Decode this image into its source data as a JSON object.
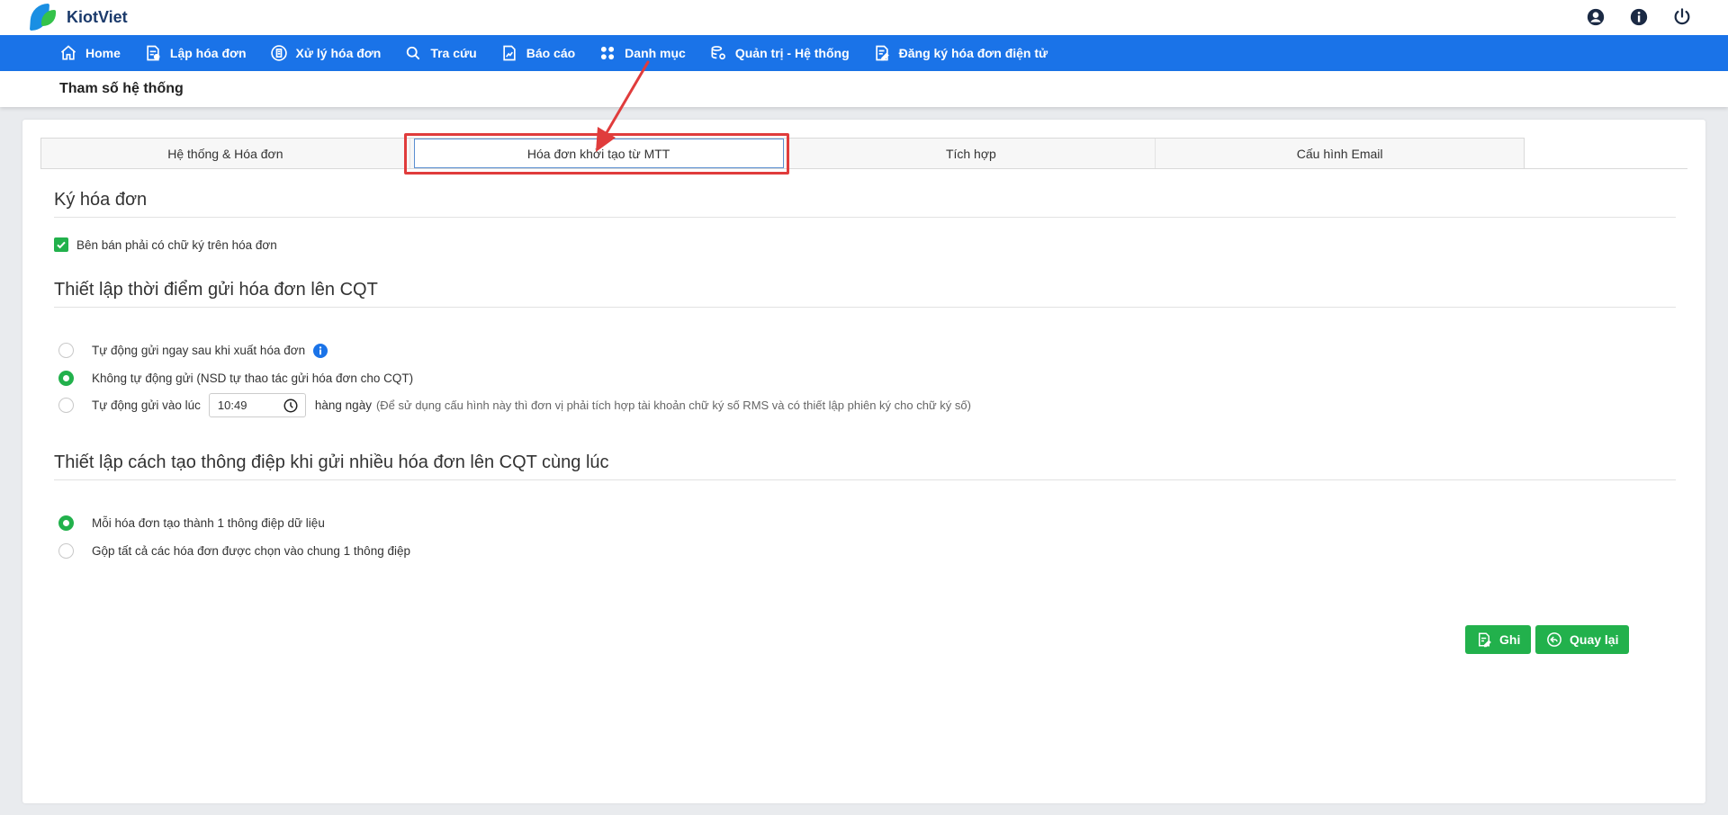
{
  "app": {
    "logo_text": "KiotViet"
  },
  "top_icons": [
    "user-icon",
    "info-icon",
    "power-icon"
  ],
  "nav": [
    {
      "label": "Home",
      "icon": "home-icon"
    },
    {
      "label": "Lập hóa đơn",
      "icon": "create-invoice-icon"
    },
    {
      "label": "Xử lý hóa đơn",
      "icon": "process-invoice-icon"
    },
    {
      "label": "Tra cứu",
      "icon": "search-icon"
    },
    {
      "label": "Báo cáo",
      "icon": "report-icon"
    },
    {
      "label": "Danh mục",
      "icon": "category-icon"
    },
    {
      "label": "Quản trị - Hệ thống",
      "icon": "admin-icon"
    },
    {
      "label": "Đăng ký hóa đơn điện tử",
      "icon": "register-icon"
    }
  ],
  "page_title": "Tham số hệ thống",
  "tabs": [
    {
      "label": "Hệ thống & Hóa đơn",
      "active": false
    },
    {
      "label": "Hóa đơn khởi tạo từ MTT",
      "active": true
    },
    {
      "label": "Tích hợp",
      "active": false
    },
    {
      "label": "Cấu hình Email",
      "active": false
    }
  ],
  "sections": {
    "sign": {
      "title": "Ký hóa đơn",
      "checkbox_label": "Bên bán phải có chữ ký trên hóa đơn",
      "checked": true
    },
    "send_time": {
      "title": "Thiết lập thời điểm gửi hóa đơn lên CQT",
      "option_auto": "Tự động gửi ngay sau khi xuất hóa đơn",
      "option_manual": "Không tự động gửi (NSD tự thao tác gửi hóa đơn cho CQT)",
      "option_scheduled": "Tự động gửi vào lúc",
      "time_value": "10:49",
      "daily_label": "hàng ngày",
      "note": "(Để sử dụng cấu hình này thì đơn vị phải tích hợp tài khoản chữ ký số RMS và có thiết lập phiên ký cho chữ ký số)",
      "selected": "manual"
    },
    "message": {
      "title": "Thiết lập cách tạo thông điệp khi gửi nhiều hóa đơn lên CQT cùng lúc",
      "option_each": "Mỗi hóa đơn tạo thành 1 thông điệp dữ liệu",
      "option_merge": "Gộp tất cả các hóa đơn được chọn vào chung 1 thông điệp",
      "selected": "each"
    }
  },
  "buttons": {
    "save": "Ghi",
    "back": "Quay lại"
  },
  "colors": {
    "nav": "#1a73e8",
    "green": "#22b14c",
    "highlight": "#e03c3c"
  }
}
